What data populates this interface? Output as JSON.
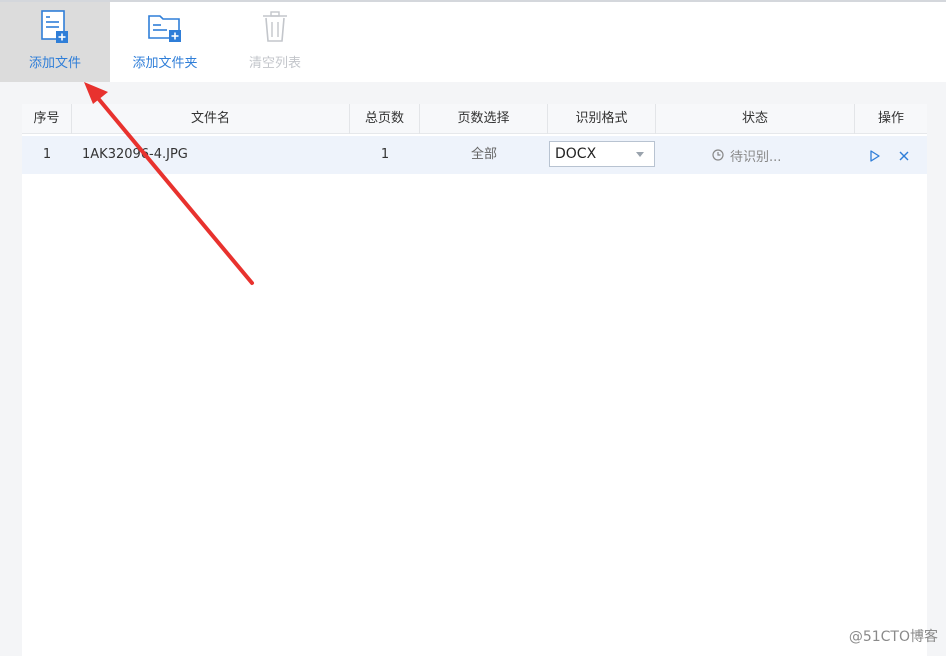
{
  "toolbar": {
    "add_file": "添加文件",
    "add_folder": "添加文件夹",
    "clear_list": "清空列表"
  },
  "table": {
    "headers": {
      "index": "序号",
      "filename": "文件名",
      "total_pages": "总页数",
      "page_select": "页数选择",
      "format": "识别格式",
      "status": "状态",
      "action": "操作"
    },
    "rows": [
      {
        "index": "1",
        "filename": "1AK32096-4.JPG",
        "total_pages": "1",
        "page_select": "全部",
        "format": "DOCX",
        "status": "待识别..."
      }
    ]
  },
  "icons": {
    "add_file": "file-add-icon",
    "add_folder": "folder-add-icon",
    "clear_list": "trash-icon",
    "status": "clock-icon",
    "start": "play-icon",
    "remove": "close-icon"
  },
  "colors": {
    "accent": "#2f7ed8",
    "annotation_arrow": "#e8322e"
  },
  "watermark": "@51CTO博客"
}
